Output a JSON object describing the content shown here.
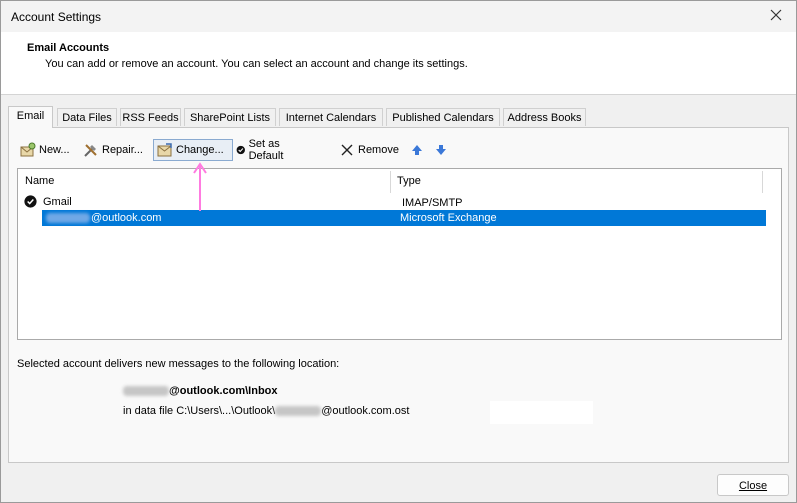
{
  "window": {
    "title": "Account Settings"
  },
  "header": {
    "title": "Email Accounts",
    "description": "You can add or remove an account. You can select an account and change its settings."
  },
  "tabs": [
    {
      "label": "Email"
    },
    {
      "label": "Data Files"
    },
    {
      "label": "RSS Feeds"
    },
    {
      "label": "SharePoint Lists"
    },
    {
      "label": "Internet Calendars"
    },
    {
      "label": "Published Calendars"
    },
    {
      "label": "Address Books"
    }
  ],
  "toolbar": {
    "new_label": "New...",
    "repair_label": "Repair...",
    "change_label": "Change...",
    "set_default_label": "Set as Default",
    "remove_label": "Remove"
  },
  "accounts_table": {
    "columns": [
      "Name",
      "Type"
    ],
    "rows": [
      {
        "name": "Gmail",
        "type": "IMAP/SMTP",
        "is_default": true
      },
      {
        "name": "@outlook.com",
        "type": "Microsoft Exchange",
        "is_default": false,
        "selected": true
      }
    ]
  },
  "delivery": {
    "label": "Selected account delivers new messages to the following location:",
    "inbox_path": "@outlook.com\\Inbox",
    "data_file_prefix": "in data file C:\\Users\\...\\Outlook\\",
    "data_file_suffix": "@outlook.com.ost"
  },
  "footer": {
    "close_label": "Close"
  },
  "colors": {
    "selection": "#0078d7",
    "annotation_arrow": "#ff7be0"
  }
}
